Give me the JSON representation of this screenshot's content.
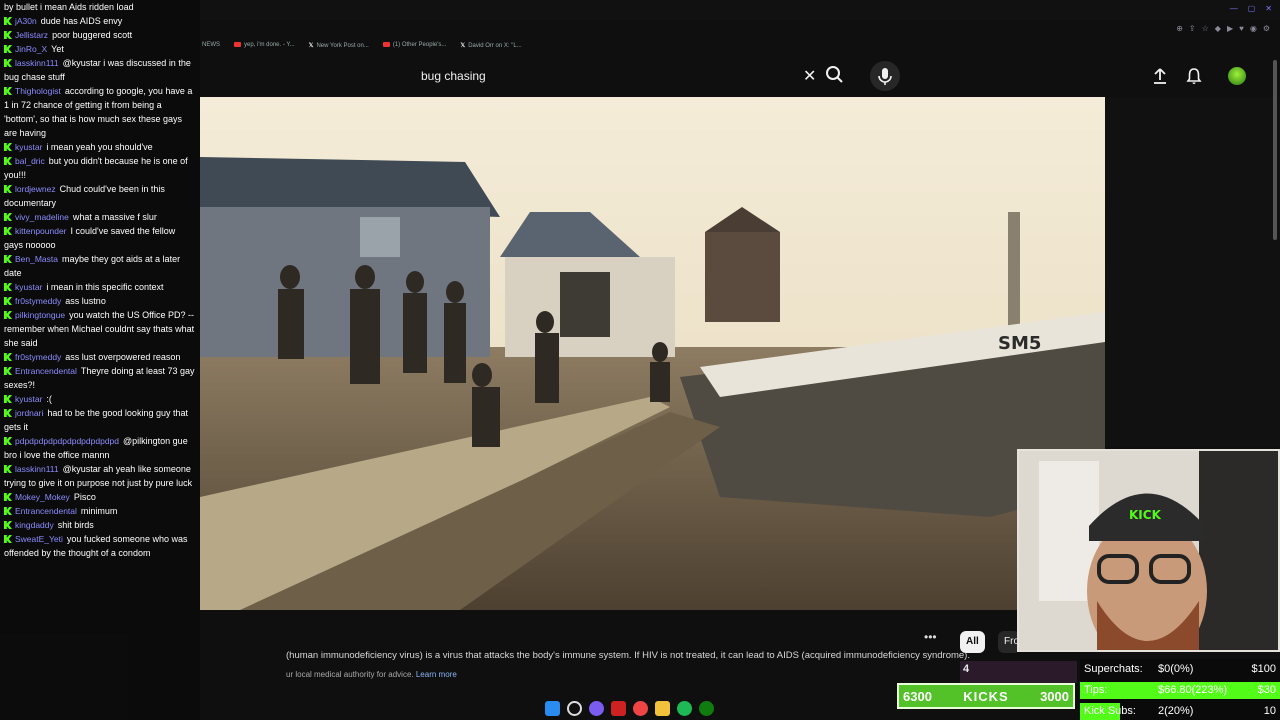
{
  "browser": {
    "bookmarks": [
      {
        "label": "NEWS",
        "icon": "none"
      },
      {
        "label": "yep, i'm done. - Y...",
        "icon": "youtube"
      },
      {
        "label": "New York Post on...",
        "icon": "x"
      },
      {
        "label": "(1) Other People's...",
        "icon": "youtube"
      },
      {
        "label": "David Orr on X: \"L...",
        "icon": "x"
      }
    ]
  },
  "youtube": {
    "search": {
      "query": "bug chasing"
    },
    "info": {
      "line1": "(human immunodeficiency virus) is a virus that attacks the body's immune system. If HIV is not treated, it can lead to AIDS (acquired immunodeficiency syndrome).",
      "line2": "ur local medical authority for advice.",
      "learn_more": "Learn more"
    },
    "chips": {
      "all": "All",
      "from": "Fro"
    },
    "more": "•••"
  },
  "chat": {
    "messages": [
      {
        "user": "",
        "text": "by bullet i mean Aids ridden load"
      },
      {
        "user": "jA30n",
        "text": "dude has AIDS envy"
      },
      {
        "user": "Jellistarz",
        "text": "poor buggered scott"
      },
      {
        "user": "JinRo_X",
        "text": "Yet"
      },
      {
        "user": "lasskinn111",
        "text": "@kyustar i was discussed in the bug chase stuff"
      },
      {
        "user": "Thighologist",
        "text": "according to google, you have a 1 in 72 chance of getting it from being a 'bottom', so that is how much sex these gays are having"
      },
      {
        "user": "kyustar",
        "text": "i mean yeah you should've"
      },
      {
        "user": "bal_dric",
        "text": "but you didn't because he is one of you!!!"
      },
      {
        "user": "lordjewnez",
        "text": "Chud could've been in this documentary"
      },
      {
        "user": "vivy_madeline",
        "text": "what a massive f slur"
      },
      {
        "user": "kittenpounder",
        "text": "I could've saved the fellow gays nooooo"
      },
      {
        "user": "Ben_Masta",
        "text": "maybe they got aids at a later date"
      },
      {
        "user": "kyustar",
        "text": "i mean in this specific context"
      },
      {
        "user": "fr0stymeddy",
        "text": "ass lustno"
      },
      {
        "user": "pilkingtongue",
        "text": "you watch the US Office PD? -- remember when Michael couldnt say thats what she said"
      },
      {
        "user": "fr0stymeddy",
        "text": "ass lust overpowered reason"
      },
      {
        "user": "Entrancendental",
        "text": "Theyre doing at least 73 gay sexes?!"
      },
      {
        "user": "kyustar",
        "text": ":("
      },
      {
        "user": "jordnari",
        "text": "had to be the good looking guy that gets it"
      },
      {
        "user": "pdpdpdpdpdpdpdpdpdpdpd",
        "text": "@pilkington gue bro i love the office mannn"
      },
      {
        "user": "lasskinn111",
        "text": "@kyustar ah yeah like someone trying to give it on purpose not just by pure luck"
      },
      {
        "user": "Mokey_Mokey",
        "text": "Pisco"
      },
      {
        "user": "Entrancendental",
        "text": "minimum"
      },
      {
        "user": "kingdaddy",
        "text": "shit birds"
      },
      {
        "user": "SweatE_Yeti",
        "text": "you fucked someone who was offended by the thought of a condom"
      }
    ]
  },
  "goals": {
    "kicks": {
      "current": "6300",
      "label": "KICKS",
      "target": "3000"
    },
    "rows": [
      {
        "label": "Superchats:",
        "value": "$0(0%)",
        "target": "$100",
        "fill": 0
      },
      {
        "label": "Tips:",
        "value": "$66.80(223%)",
        "target": "$30",
        "fill": 1
      },
      {
        "label": "Kick Subs:",
        "value": "2(20%)",
        "target": "10",
        "fill": 0.2
      }
    ],
    "badge_num": "4"
  },
  "colors": {
    "kick_green": "#53fc18",
    "yt_bg": "#0f0f0f",
    "chat_user": "#8c8cff"
  }
}
